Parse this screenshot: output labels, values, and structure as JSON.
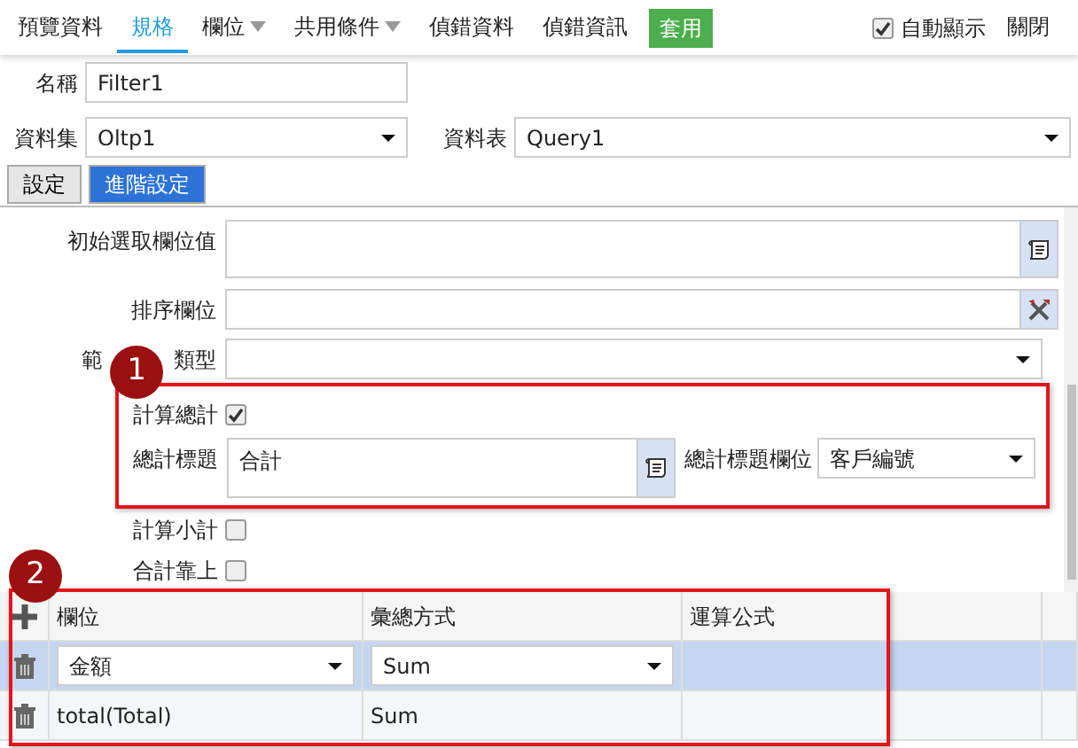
{
  "menu": [
    {
      "label": "預覽資料",
      "kind": "link",
      "selected": false
    },
    {
      "label": "規格",
      "kind": "link",
      "selected": true
    },
    {
      "label": "欄位",
      "kind": "dropdown",
      "selected": false
    },
    {
      "label": "共用條件",
      "kind": "dropdown",
      "selected": false
    },
    {
      "label": "偵錯資料",
      "kind": "link",
      "selected": false
    },
    {
      "label": "偵錯資訊",
      "kind": "link",
      "selected": false
    }
  ],
  "apply": "套用",
  "auto_show": {
    "label": "自動顯示",
    "checked": true
  },
  "close": "關閉",
  "name": {
    "label": "名稱",
    "value": "Filter1"
  },
  "dataset": {
    "label": "資料集",
    "value": "Oltp1"
  },
  "datatable": {
    "label": "資料表",
    "value": "Query1"
  },
  "tabs": [
    {
      "label": "設定",
      "selected": false
    },
    {
      "label": "進階設定",
      "selected": true
    }
  ],
  "fields": [
    {
      "label": "初始選取欄位值",
      "kind": "textarea"
    },
    {
      "label": "排序欄位",
      "kind": "text"
    },
    {
      "label_start": "範",
      "label_end": "類型",
      "kind": "select"
    }
  ],
  "callout_1": {
    "number": "1",
    "calc_total": {
      "label": "計算總計",
      "checked": true
    },
    "total_title": {
      "label": "總計標題",
      "value": "合計"
    },
    "total_title_field": {
      "label": "總計標題欄位",
      "value": "客戶編號"
    }
  },
  "options": [
    {
      "label": "計算小計",
      "checked": false
    },
    {
      "label": "合計靠上",
      "checked": false
    }
  ],
  "callout_2": {
    "number": "2"
  },
  "table": {
    "columns": [
      "欄位",
      "彙總方式",
      "運算公式"
    ],
    "rows": [
      {
        "selected": true,
        "field": "金額",
        "aggregate": "Sum"
      },
      {
        "selected": false,
        "field": "total(Total)",
        "aggregate": "Sum"
      }
    ]
  }
}
